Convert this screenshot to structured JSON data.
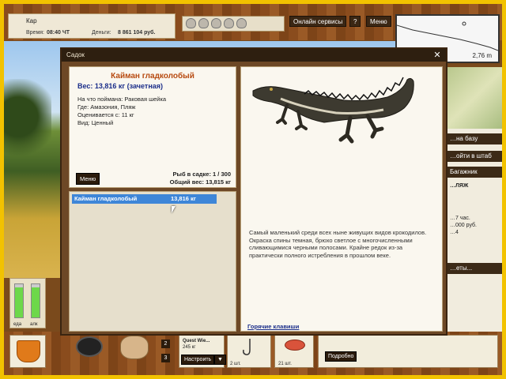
{
  "header": {
    "location": "Кар",
    "time_label": "Время:",
    "time_value": "08:40 ЧТ",
    "money_label": "Деньги:",
    "money_value": "8 861 104 руб.",
    "online_button": "Онлайн сервисы",
    "help_button": "?",
    "menu_button": "Меню"
  },
  "minimap": {
    "depth": "2,76 m"
  },
  "right_panel": {
    "to_base": "…на базу",
    "to_hq": "…ойти в штаб",
    "trunk": "Багажник",
    "beach": "…ЛЯЖ",
    "line1": "…7 час.",
    "line2": "…000 руб.",
    "line3": "…4",
    "tasks": "…еты..."
  },
  "meters": {
    "food_label": "еда",
    "alcohol_label": "алк",
    "food_level": 0.9,
    "alcohol_level": 0.9
  },
  "bottom": {
    "counter1": "2",
    "counter2": "3",
    "bait_name": "Quest Wie...",
    "bait_weight": "245 кг",
    "setup_button": "Настроить",
    "hook_count": "2 шт.",
    "shrimp_count": "21 шт.",
    "details_button": "Подробно"
  },
  "dialog": {
    "title": "Садок",
    "close": "✕",
    "fish_name": "Кайман гладколобый",
    "fish_weight": "Вес: 13,816 кг (зачетная)",
    "caught_on": "На что поймана: Раковая шейка",
    "where": "Где: Амазония, Пляж",
    "valued_from": "Оценивается с: 11 кг",
    "kind": "Вид: Ценный",
    "menu_button": "Меню",
    "fish_in_keepnet": "Рыб в садке: 1 / 300",
    "total_weight": "Общий вес: 13,815 кг",
    "list": [
      {
        "name": "Кайман гладколобый",
        "weight": "13,816 кг"
      }
    ],
    "description": "Самый маленький среди всех ныне живущих видов крокодилов. Окраска спины темная, брюхо светлое с многочисленными сливающимися черными полосами. Крайне редок из-за практически полного истребления в прошлом веке.",
    "hotkeys": "Горячие клавиши"
  }
}
